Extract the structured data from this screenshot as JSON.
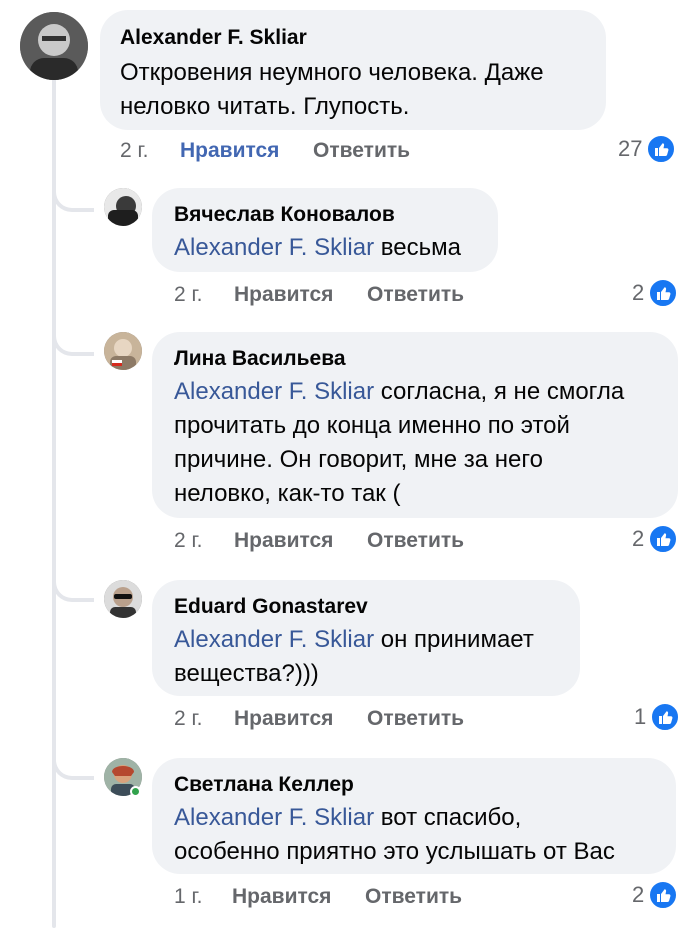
{
  "comments": [
    {
      "author": "Alexander F. Skliar",
      "text": "Откровения неумного человека. Даже\nнеловко читать. Глупость.",
      "time": "2 г.",
      "like_label": "Нравится",
      "reply_label": "Ответить",
      "reactions": "27",
      "like_active": true
    },
    {
      "author": "Вячеслав Коновалов",
      "mention": "Alexander F. Skliar",
      "text": " весьма",
      "time": "2 г.",
      "like_label": "Нравится",
      "reply_label": "Ответить",
      "reactions": "2"
    },
    {
      "author": "Лина Васильева",
      "mention": "Alexander F. Skliar",
      "text": " согласна, я не смогла\nпрочитать до конца именно по этой\nпричине. Он говорит, мне за него\nнеловко, как-то так (",
      "time": "2 г.",
      "like_label": "Нравится",
      "reply_label": "Ответить",
      "reactions": "2"
    },
    {
      "author": "Eduard Gonastarev",
      "mention": "Alexander F. Skliar",
      "text": " он принимает\nвещества?)))",
      "time": "2 г.",
      "like_label": "Нравится",
      "reply_label": "Ответить",
      "reactions": "1"
    },
    {
      "author": "Светлана Келлер",
      "mention": "Alexander F. Skliar",
      "text": " вот спасибо,\nособенно приятно это услышать от Вас",
      "time": "1 г.",
      "like_label": "Нравится",
      "reply_label": "Ответить",
      "reactions": "2"
    }
  ],
  "colors": {
    "bubble": "#f0f2f5",
    "mention": "#385898",
    "like_active": "#4267b2",
    "reaction_badge": "#1877f2",
    "online": "#31a24c"
  },
  "icons": {
    "reaction": "thumbs-up-icon",
    "presence": "online-status-icon"
  }
}
